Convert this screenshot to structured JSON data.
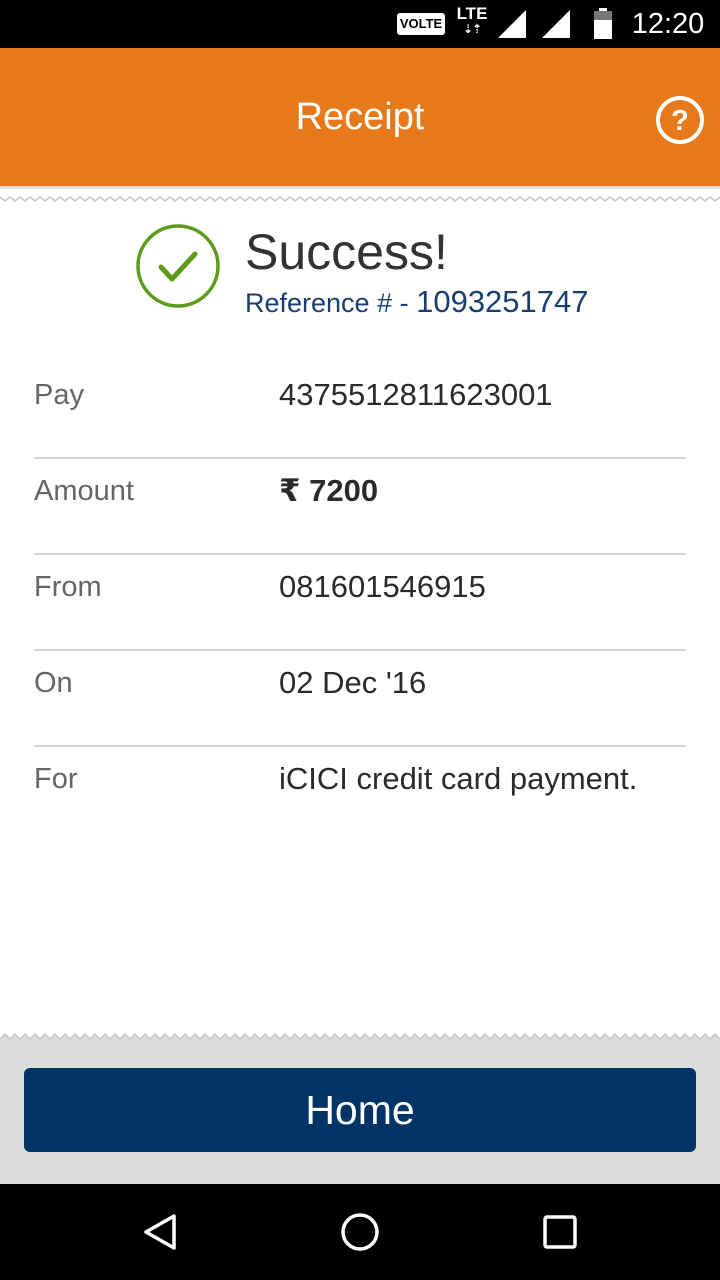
{
  "status_bar": {
    "volte": "VOLTE",
    "network": "LTE",
    "network_arrows": "⇣⇡",
    "time": "12:20",
    "icons": [
      "signal-icon",
      "battery-icon"
    ]
  },
  "header": {
    "title": "Receipt",
    "help_icon": "help-circle-icon"
  },
  "status": {
    "title": "Success!",
    "reference_label": "Reference # - ",
    "reference_number": "1093251747",
    "icon": "check-circle-icon"
  },
  "details": [
    {
      "label": "Pay",
      "value": "4375512811623001"
    },
    {
      "label": "Amount",
      "value": "₹ 7200"
    },
    {
      "label": "From",
      "value": "081601546915"
    },
    {
      "label": "On",
      "value": "02 Dec '16"
    },
    {
      "label": "For",
      "value": "iCICI credit card payment."
    }
  ],
  "actions": {
    "home_label": "Home"
  },
  "colors": {
    "header": "#e8791a",
    "primary_button": "#003366",
    "reference_text": "#1a3e72",
    "success_green": "#5d9b1b"
  }
}
